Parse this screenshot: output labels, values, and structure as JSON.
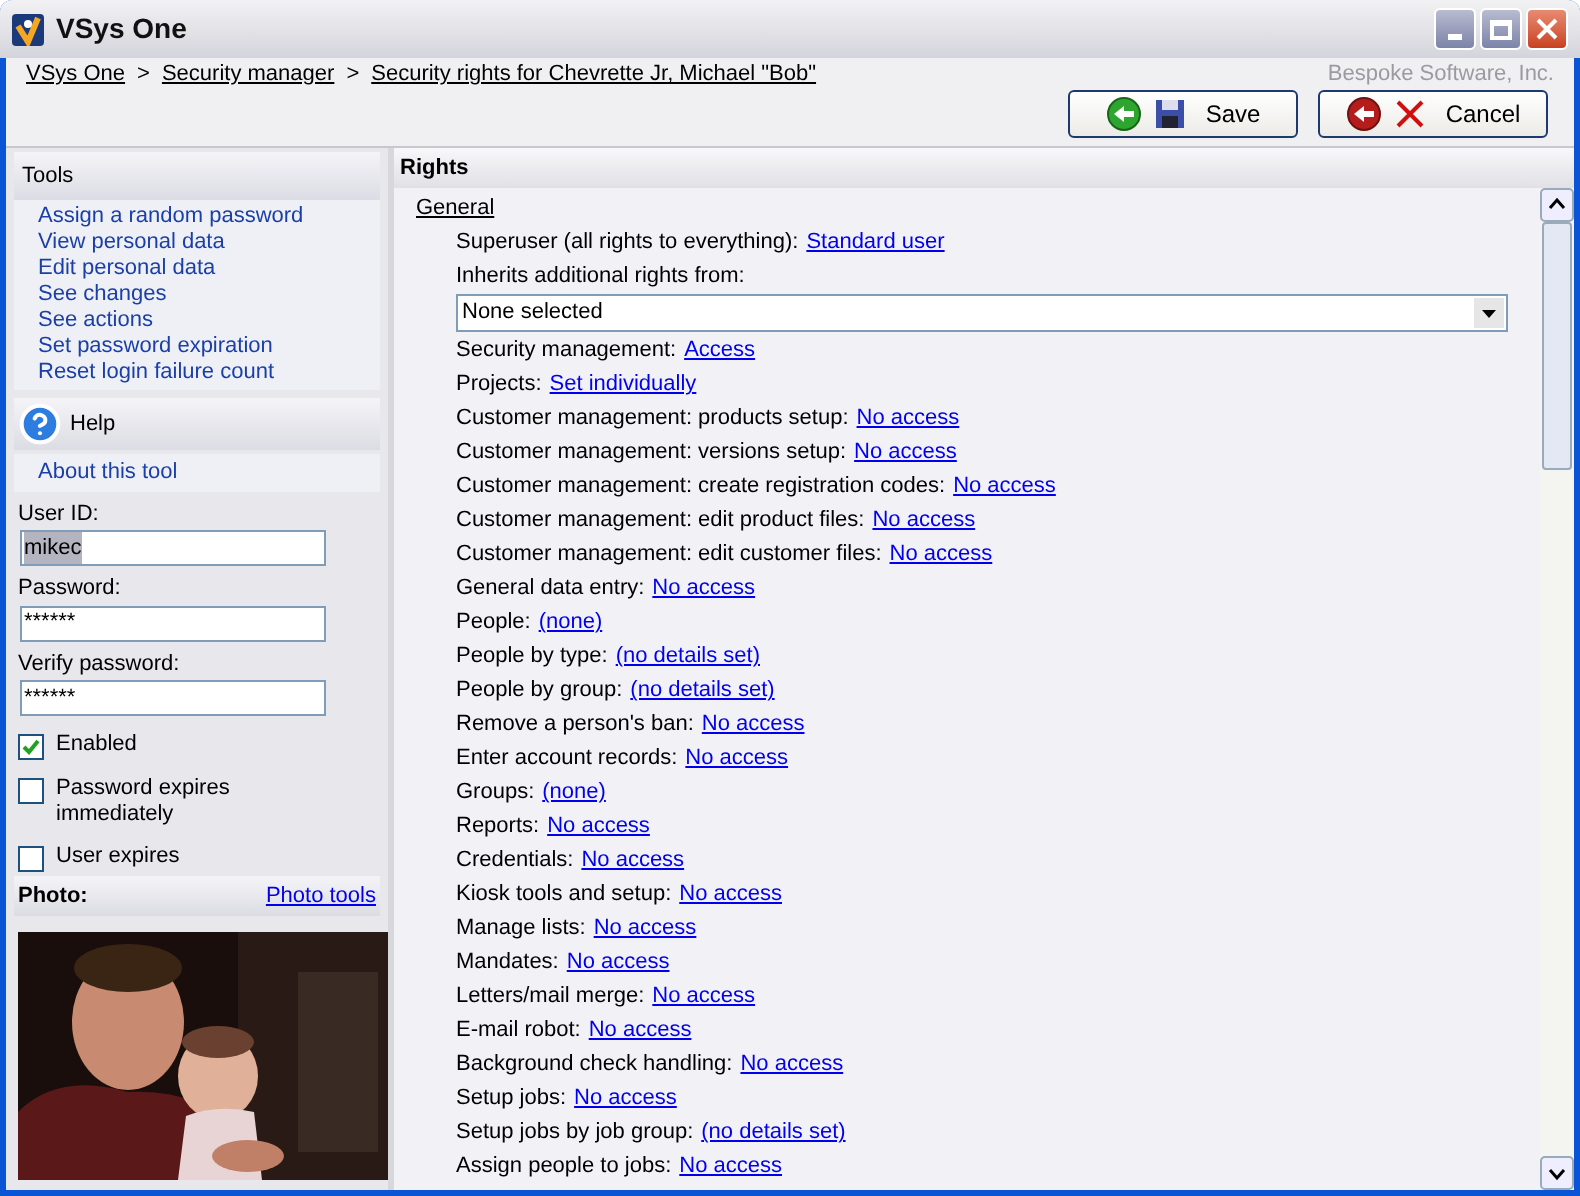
{
  "window": {
    "title": "VSys One"
  },
  "breadcrumb": [
    "VSys One",
    "Security manager",
    "Security rights for Chevrette Jr, Michael \"Bob\""
  ],
  "breadcrumb_separator": ">",
  "company": "Bespoke Software, Inc.",
  "buttons": [
    {
      "kind": "save",
      "label": "Save"
    },
    {
      "kind": "cancel",
      "label": "Cancel"
    }
  ],
  "tools": {
    "title": "Tools",
    "items": [
      "Assign a random password",
      "View personal data",
      "Edit personal data",
      "See changes",
      "See actions",
      "Set password expiration",
      "Reset login failure count"
    ]
  },
  "help": {
    "title": "Help",
    "items": [
      "About this tool"
    ]
  },
  "fields": [
    {
      "label": "User ID:",
      "value": "mikec",
      "selected_text": true
    },
    {
      "label": "Password:",
      "value": "******",
      "selected_text": false
    },
    {
      "label": "Verify password:",
      "value": "******",
      "selected_text": false
    }
  ],
  "checkboxes": [
    {
      "label": "Enabled",
      "checked": true
    },
    {
      "label": "Password expires immediately",
      "checked": false
    },
    {
      "label": "User expires",
      "checked": false
    }
  ],
  "photo": {
    "title": "Photo:",
    "link": "Photo tools",
    "kind": "picture"
  },
  "rights": {
    "title": "Rights",
    "section": "General",
    "superuser": {
      "label": "Superuser (all rights to everything):",
      "link": "Standard user"
    },
    "inherits": {
      "label": "Inherits additional rights from:",
      "value": "None selected"
    },
    "rows": [
      {
        "label": "Security management:",
        "link": "Access"
      },
      {
        "label": "Projects:",
        "link": "Set individually"
      },
      {
        "label": "Customer management: products setup:",
        "link": "No access"
      },
      {
        "label": "Customer management: versions setup:",
        "link": "No access"
      },
      {
        "label": "Customer management: create registration codes:",
        "link": "No access"
      },
      {
        "label": "Customer management: edit product files:",
        "link": "No access"
      },
      {
        "label": "Customer management: edit customer files:",
        "link": "No access"
      },
      {
        "label": "General data entry:",
        "link": "No access"
      },
      {
        "label": "People:",
        "link": "(none)"
      },
      {
        "label": "People by type:",
        "link": "(no details set)"
      },
      {
        "label": "People by group:",
        "link": "(no details set)"
      },
      {
        "label": "Remove a person's ban:",
        "link": "No access"
      },
      {
        "label": "Enter account records:",
        "link": "No access"
      },
      {
        "label": "Groups:",
        "link": "(none)"
      },
      {
        "label": "Reports:",
        "link": "No access"
      },
      {
        "label": "Credentials:",
        "link": "No access"
      },
      {
        "label": "Kiosk tools and setup:",
        "link": "No access"
      },
      {
        "label": "Manage lists:",
        "link": "No access"
      },
      {
        "label": "Mandates:",
        "link": "No access"
      },
      {
        "label": "Letters/mail merge:",
        "link": "No access"
      },
      {
        "label": "E-mail robot:",
        "link": "No access"
      },
      {
        "label": "Background check handling:",
        "link": "No access"
      },
      {
        "label": "Setup jobs:",
        "link": "No access"
      },
      {
        "label": "Setup jobs by job group:",
        "link": "(no details set)"
      },
      {
        "label": "Assign people to jobs:",
        "link": "No access"
      }
    ]
  }
}
